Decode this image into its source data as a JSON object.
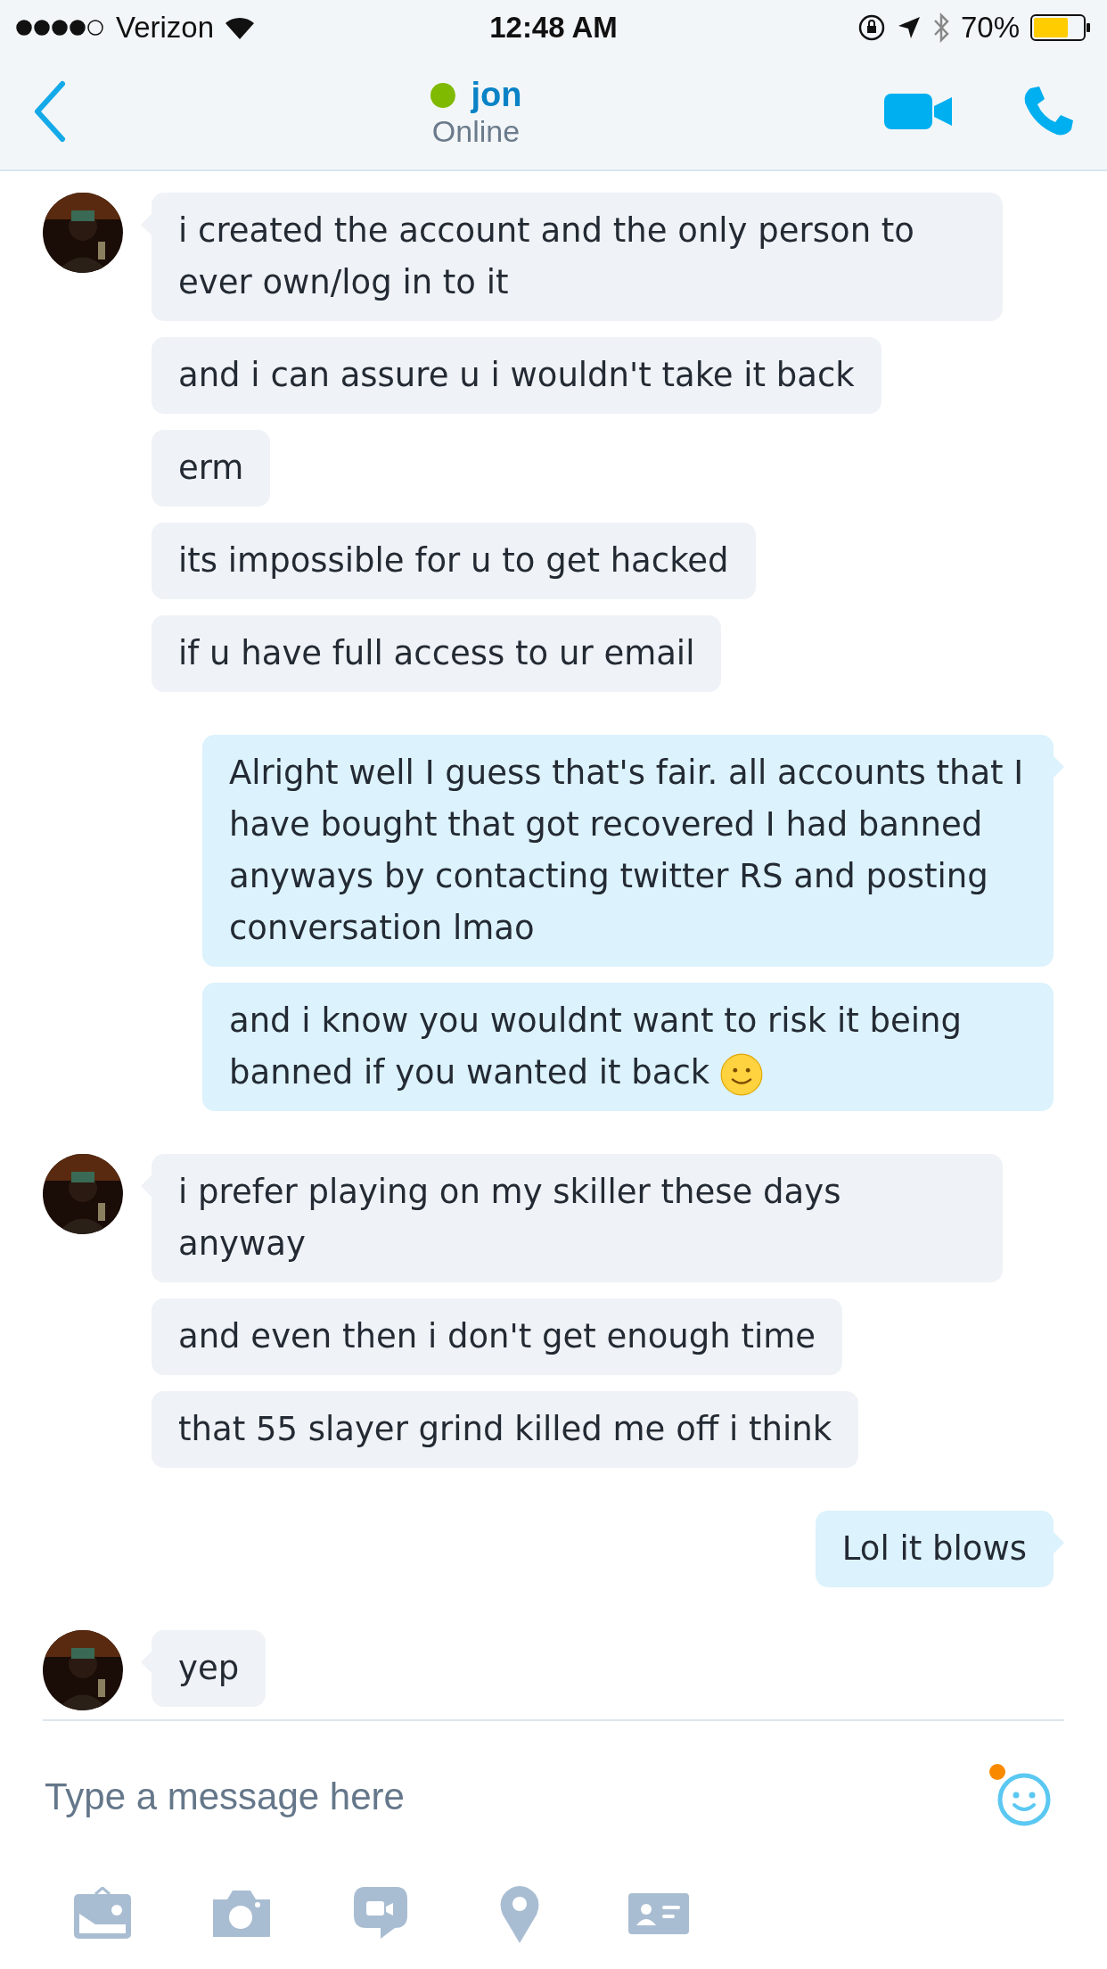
{
  "status_bar": {
    "carrier": "Verizon",
    "time": "12:48 AM",
    "battery": "70%"
  },
  "header": {
    "name": "jon",
    "status": "Online"
  },
  "messages": [
    {
      "kind": "incoming",
      "first": true,
      "text": "i created the account and the only person to ever own/log in to it"
    },
    {
      "kind": "incoming",
      "first": false,
      "text": "and i can assure u i wouldn't take it back"
    },
    {
      "kind": "incoming",
      "first": false,
      "text": "erm"
    },
    {
      "kind": "incoming",
      "first": false,
      "text": "its impossible for u to get hacked"
    },
    {
      "kind": "incoming",
      "first": false,
      "text": "if u have full access to ur email"
    },
    {
      "kind": "outgoing",
      "first": true,
      "text": "Alright well I guess that's fair. all accounts that I have bought that got recovered I had banned anyways by contacting twitter RS and posting conversation lmao"
    },
    {
      "kind": "outgoing",
      "first": false,
      "text": "and i know you wouldnt want to risk it being banned if you wanted it back",
      "emoji": true
    },
    {
      "kind": "incoming",
      "first": true,
      "text": "i prefer playing on my skiller these days anyway"
    },
    {
      "kind": "incoming",
      "first": false,
      "text": "and even then i don't get enough time"
    },
    {
      "kind": "incoming",
      "first": false,
      "text": "that 55 slayer grind killed me off i think"
    },
    {
      "kind": "outgoing",
      "first": true,
      "text": "Lol it blows"
    },
    {
      "kind": "incoming",
      "first": true,
      "text": "yep"
    }
  ],
  "composer": {
    "placeholder": "Type a message here",
    "emoji_badge": true
  }
}
